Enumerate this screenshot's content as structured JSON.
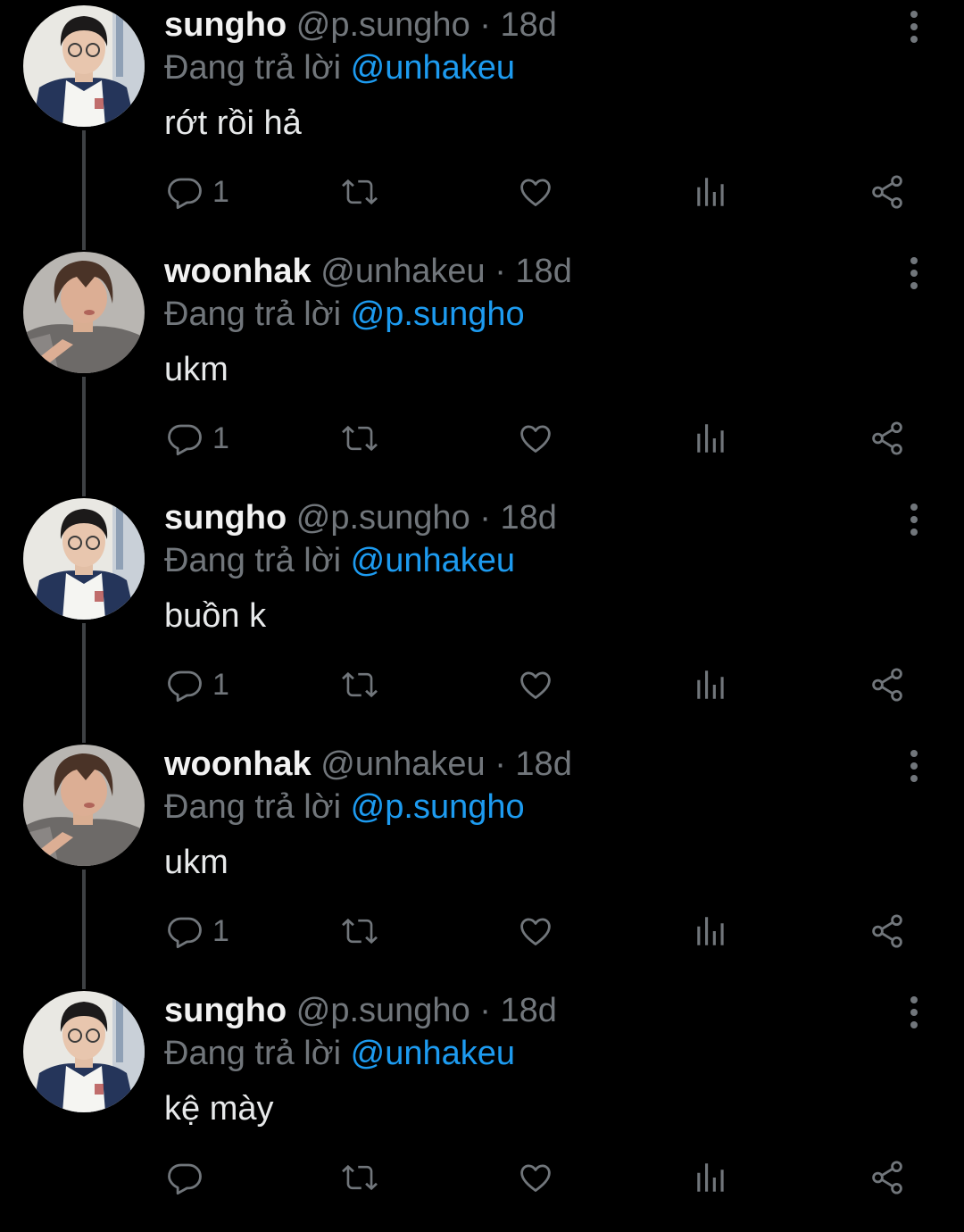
{
  "thread": [
    {
      "author": {
        "name": "sungho",
        "handle": "@p.sungho",
        "avatar": "avatar-sungho"
      },
      "separator": "·",
      "time": "18d",
      "reply_prefix": "Đang trả lời",
      "reply_to": "@unhakeu",
      "text": "rớt rồi hả",
      "reply_count": "1"
    },
    {
      "author": {
        "name": "woonhak",
        "handle": "@unhakeu",
        "avatar": "avatar-woonhak"
      },
      "separator": "·",
      "time": "18d",
      "reply_prefix": "Đang trả lời",
      "reply_to": "@p.sungho",
      "text": "ukm",
      "reply_count": "1"
    },
    {
      "author": {
        "name": "sungho",
        "handle": "@p.sungho",
        "avatar": "avatar-sungho"
      },
      "separator": "·",
      "time": "18d",
      "reply_prefix": "Đang trả lời",
      "reply_to": "@unhakeu",
      "text": "buồn k",
      "reply_count": "1"
    },
    {
      "author": {
        "name": "woonhak",
        "handle": "@unhakeu",
        "avatar": "avatar-woonhak"
      },
      "separator": "·",
      "time": "18d",
      "reply_prefix": "Đang trả lời",
      "reply_to": "@p.sungho",
      "text": "ukm",
      "reply_count": "1"
    },
    {
      "author": {
        "name": "sungho",
        "handle": "@p.sungho",
        "avatar": "avatar-sungho"
      },
      "separator": "·",
      "time": "18d",
      "reply_prefix": "Đang trả lời",
      "reply_to": "@unhakeu",
      "text": "kệ mày",
      "reply_count": ""
    }
  ],
  "icons": {
    "reply": "reply-icon",
    "retweet": "retweet-icon",
    "like": "like-icon",
    "views": "views-icon",
    "share": "share-icon",
    "more": "more-vertical-icon"
  },
  "colors": {
    "background": "#000000",
    "text": "#e7e9ea",
    "secondary": "#71767b",
    "accent": "#1d9bf0",
    "thread_line": "#3e4144"
  }
}
